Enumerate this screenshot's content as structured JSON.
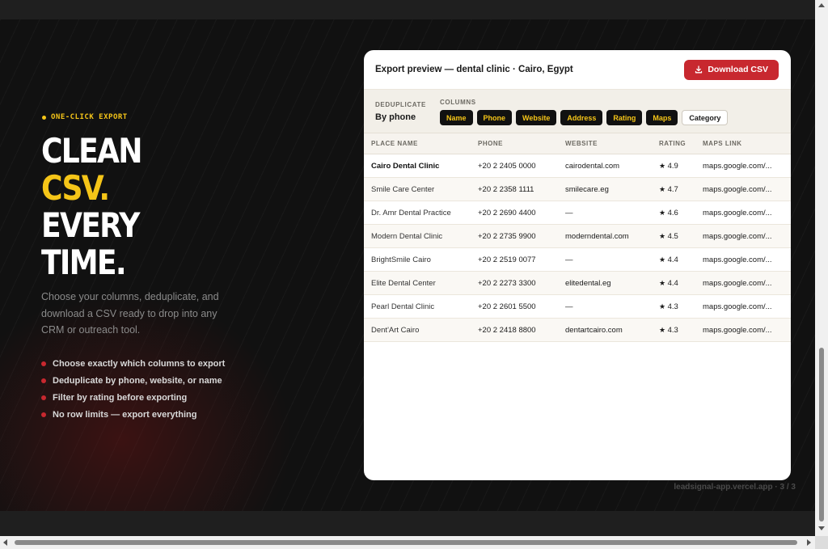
{
  "eyebrow": "ONE-CLICK EXPORT",
  "headline": {
    "line1": "CLEAN",
    "line2": "CSV.",
    "line3": "EVERY",
    "line4": "TIME."
  },
  "description": "Choose your columns, deduplicate, and download a CSV ready to drop into any CRM or outreach tool.",
  "bullets": [
    "Choose exactly which columns to export",
    "Deduplicate by phone, website, or name",
    "Filter by rating before exporting",
    "No row limits — export everything"
  ],
  "footer_note": "leadsignal-app.vercel.app · 3 / 3",
  "card": {
    "title": "Export preview — dental clinic · Cairo, Egypt",
    "download_label": "Download CSV",
    "dedup_label": "DEDUPLICATE",
    "dedup_value": "By phone",
    "columns_label": "COLUMNS",
    "chips": [
      "Name",
      "Phone",
      "Website",
      "Address",
      "Rating",
      "Maps"
    ],
    "chip_off": "Category",
    "headers": [
      "PLACE NAME",
      "PHONE",
      "WEBSITE",
      "RATING",
      "MAPS LINK"
    ],
    "rows": [
      {
        "name": "Cairo Dental Clinic",
        "phone": "+20 2 2405 0000",
        "website": "cairodental.com",
        "rating": "4.9",
        "maps": "maps.google.com/..."
      },
      {
        "name": "Smile Care Center",
        "phone": "+20 2 2358 1111",
        "website": "smilecare.eg",
        "rating": "4.7",
        "maps": "maps.google.com/..."
      },
      {
        "name": "Dr. Amr Dental Practice",
        "phone": "+20 2 2690 4400",
        "website": "—",
        "rating": "4.6",
        "maps": "maps.google.com/..."
      },
      {
        "name": "Modern Dental Clinic",
        "phone": "+20 2 2735 9900",
        "website": "moderndental.com",
        "rating": "4.5",
        "maps": "maps.google.com/..."
      },
      {
        "name": "BrightSmile Cairo",
        "phone": "+20 2 2519 0077",
        "website": "—",
        "rating": "4.4",
        "maps": "maps.google.com/..."
      },
      {
        "name": "Elite Dental Center",
        "phone": "+20 2 2273 3300",
        "website": "elitedental.eg",
        "rating": "4.4",
        "maps": "maps.google.com/..."
      },
      {
        "name": "Pearl Dental Clinic",
        "phone": "+20 2 2601 5500",
        "website": "—",
        "rating": "4.3",
        "maps": "maps.google.com/..."
      },
      {
        "name": "Dent'Art Cairo",
        "phone": "+20 2 2418 8800",
        "website": "dentartcairo.com",
        "rating": "4.3",
        "maps": "maps.google.com/..."
      }
    ]
  },
  "colors": {
    "accent_yellow": "#f5c518",
    "accent_red": "#c8282f",
    "background": "#111111"
  }
}
